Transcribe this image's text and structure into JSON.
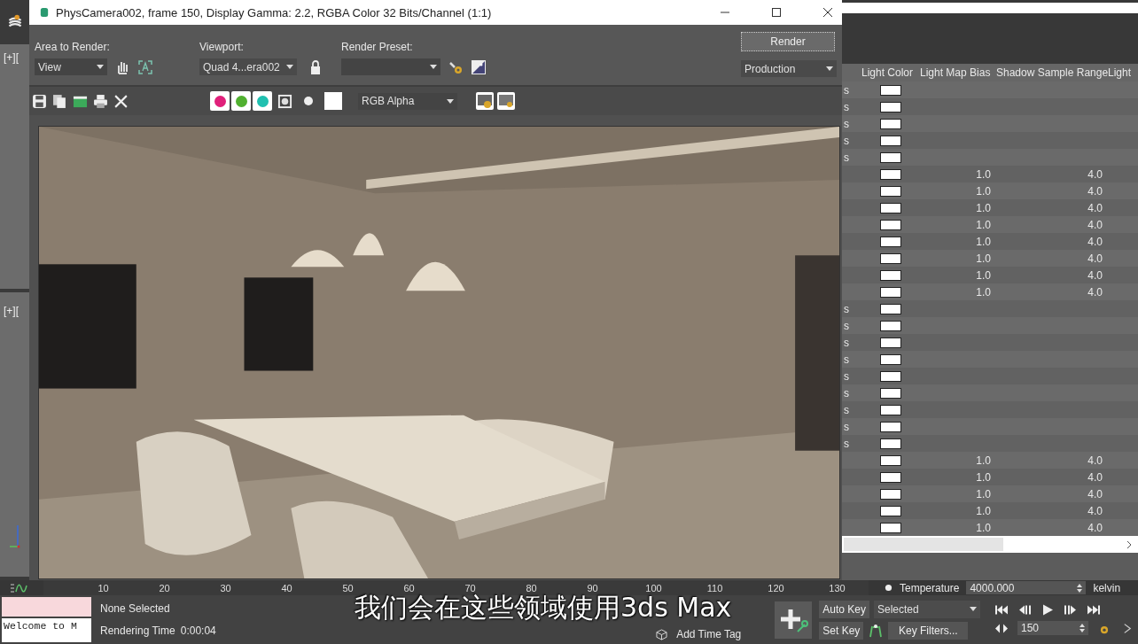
{
  "left_strip": {
    "viewport_labels": [
      "[+][",
      "[+]["
    ]
  },
  "render_window": {
    "title": "PhysCamera002, frame 150, Display Gamma: 2.2, RGBA Color 32 Bits/Channel (1:1)",
    "area_to_render": {
      "label": "Area to Render:",
      "value": "View"
    },
    "viewport": {
      "label": "Viewport:",
      "value": "Quad 4...era002"
    },
    "render_preset": {
      "label": "Render Preset:"
    },
    "render_button": "Render",
    "render_mode": "Production",
    "channel_buttons": [
      {
        "color": "#e0207a",
        "on": true
      },
      {
        "color": "#50b030",
        "on": true
      },
      {
        "color": "#20c0b0",
        "on": true
      }
    ],
    "display_channel": "RGB Alpha"
  },
  "light_table": {
    "columns": [
      "Light Color",
      "Light Map Bias",
      "Shadow Sample Range",
      "Light"
    ],
    "rows": [
      {
        "column_1": "s"
      },
      {
        "column_1": "s"
      },
      {
        "column_1": "s"
      },
      {
        "column_1": "s"
      },
      {
        "column_1": "s"
      },
      {
        "light_map_bias": "1.0",
        "shadow_sample_range": "4.0"
      },
      {
        "light_map_bias": "1.0",
        "shadow_sample_range": "4.0"
      },
      {
        "light_map_bias": "1.0",
        "shadow_sample_range": "4.0"
      },
      {
        "light_map_bias": "1.0",
        "shadow_sample_range": "4.0"
      },
      {
        "light_map_bias": "1.0",
        "shadow_sample_range": "4.0"
      },
      {
        "light_map_bias": "1.0",
        "shadow_sample_range": "4.0"
      },
      {
        "light_map_bias": "1.0",
        "shadow_sample_range": "4.0"
      },
      {
        "light_map_bias": "1.0",
        "shadow_sample_range": "4.0"
      },
      {
        "column_1": "s"
      },
      {
        "column_1": "s"
      },
      {
        "column_1": "s"
      },
      {
        "column_1": "s"
      },
      {
        "column_1": "s"
      },
      {
        "column_1": "s"
      },
      {
        "column_1": "s"
      },
      {
        "column_1": "s"
      },
      {
        "column_1": "s"
      },
      {
        "light_map_bias": "1.0",
        "shadow_sample_range": "4.0"
      },
      {
        "light_map_bias": "1.0",
        "shadow_sample_range": "4.0"
      },
      {
        "light_map_bias": "1.0",
        "shadow_sample_range": "4.0"
      },
      {
        "light_map_bias": "1.0",
        "shadow_sample_range": "4.0"
      },
      {
        "light_map_bias": "1.0",
        "shadow_sample_range": "4.0"
      }
    ]
  },
  "time_ruler": [
    "10",
    "20",
    "30",
    "40",
    "50",
    "60",
    "70",
    "80",
    "90",
    "100",
    "110",
    "120",
    "130"
  ],
  "temperature": {
    "label": "Temperature",
    "value": "4000.000",
    "unit": "kelvin"
  },
  "listener": {
    "text": "Welcome to M"
  },
  "status": {
    "selection": "None Selected",
    "rendering_time_label": "Rendering Time",
    "rendering_time": "0:00:04"
  },
  "subtitle": "我们会在这些领域使用3ds Max",
  "add_time_tag": "Add Time Tag",
  "key_controls": {
    "auto_key": "Auto Key",
    "key_set": "Selected",
    "set_key": "Set Key",
    "key_filters": "Key Filters...",
    "frame": "150"
  }
}
